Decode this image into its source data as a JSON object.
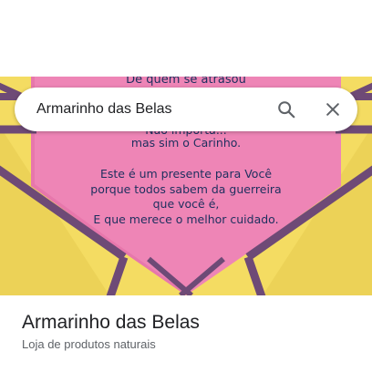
{
  "search": {
    "query": "Armarinho das Belas"
  },
  "icons": {
    "search": "search-icon",
    "close": "close-icon"
  },
  "photo": {
    "card_lines_top": [
      "De quem se atrasou"
    ],
    "card_lines_partial": [
      "Não importa..."
    ],
    "card_lines": [
      "mas sim o Carinho.",
      "",
      "Este é um presente para Você",
      "porque todos sabem da guerreira",
      "que você é,",
      "E que merece o melhor cuidado."
    ],
    "colors": {
      "background_yellow": "#f4dc62",
      "card_pink": "#ee85b6",
      "ribbon": "#6e4a76",
      "text": "#1d2f5e"
    }
  },
  "place": {
    "name": "Armarinho das Belas",
    "category": "Loja de produtos naturais"
  }
}
